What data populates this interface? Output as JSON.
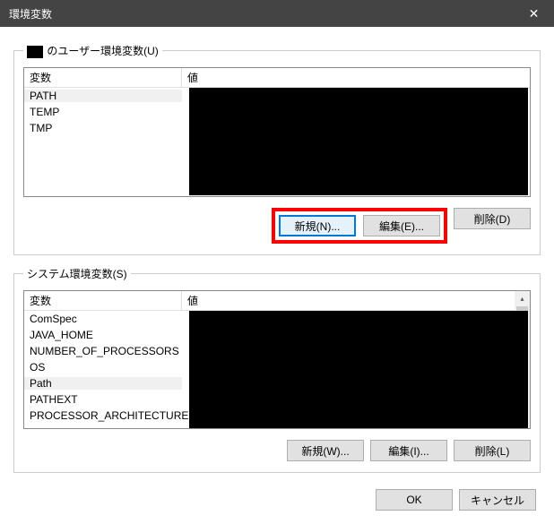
{
  "window": {
    "title": "環境変数",
    "close_icon": "✕"
  },
  "user_section": {
    "legend_suffix": " のユーザー環境変数(U)",
    "header_var": "変数",
    "header_val": "値",
    "rows": [
      {
        "name": "PATH"
      },
      {
        "name": "TEMP"
      },
      {
        "name": "TMP"
      }
    ],
    "btn_new": "新規(N)...",
    "btn_edit": "編集(E)...",
    "btn_delete": "削除(D)"
  },
  "system_section": {
    "legend": "システム環境変数(S)",
    "header_var": "変数",
    "header_val": "値",
    "rows": [
      {
        "name": "ComSpec"
      },
      {
        "name": "JAVA_HOME"
      },
      {
        "name": "NUMBER_OF_PROCESSORS"
      },
      {
        "name": "OS"
      },
      {
        "name": "Path"
      },
      {
        "name": "PATHEXT"
      },
      {
        "name": "PROCESSOR_ARCHITECTURE"
      }
    ],
    "btn_new": "新規(W)...",
    "btn_edit": "編集(I)...",
    "btn_delete": "削除(L)"
  },
  "dialog": {
    "ok": "OK",
    "cancel": "キャンセル"
  }
}
